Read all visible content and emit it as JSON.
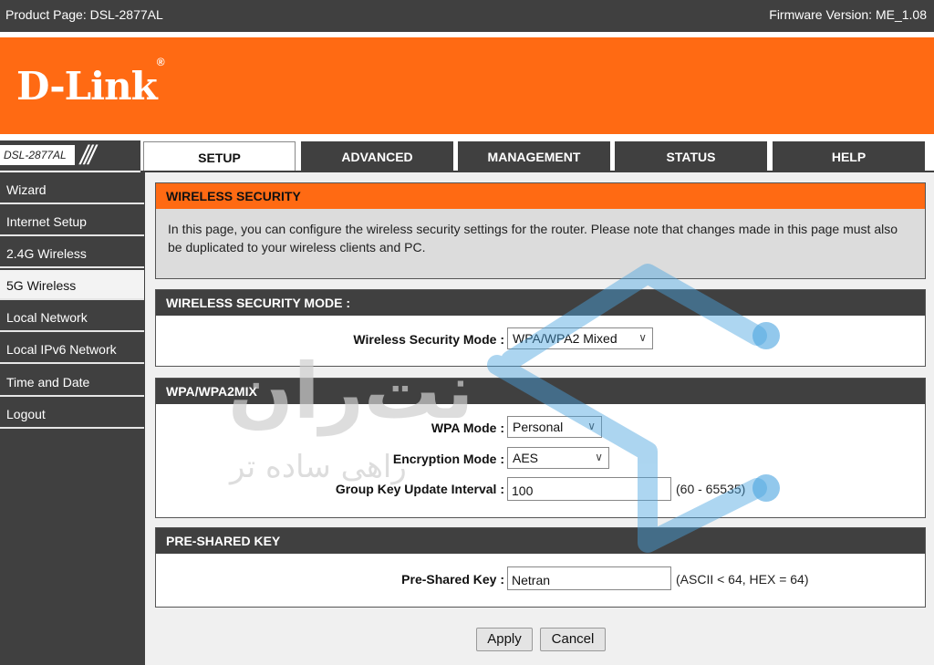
{
  "topbar": {
    "product": "Product Page: DSL-2877AL",
    "firmware": "Firmware Version: ME_1.08"
  },
  "brand": {
    "logo": "D-Link",
    "reg": "®"
  },
  "model": {
    "label": "DSL-2877AL",
    "slashes": "///"
  },
  "tabs": [
    {
      "label": "SETUP",
      "active": true
    },
    {
      "label": "ADVANCED"
    },
    {
      "label": "MANAGEMENT"
    },
    {
      "label": "STATUS"
    },
    {
      "label": "HELP"
    }
  ],
  "sidebar": {
    "items": [
      {
        "label": "Wizard"
      },
      {
        "label": "Internet Setup"
      },
      {
        "label": "2.4G Wireless"
      },
      {
        "label": "5G Wireless",
        "active": true
      },
      {
        "label": "Local Network"
      },
      {
        "label": "Local IPv6 Network"
      },
      {
        "label": "Time and Date"
      },
      {
        "label": "Logout"
      }
    ]
  },
  "intro": {
    "title": "WIRELESS SECURITY",
    "text": "In this page, you can configure the wireless security settings for the router. Please note that changes made in this page must also be duplicated to your wireless clients and PC."
  },
  "security_mode": {
    "title": "WIRELESS SECURITY MODE :",
    "label": "Wireless Security Mode :",
    "value": "WPA/WPA2 Mixed"
  },
  "wpa": {
    "title": "WPA/WPA2MIX",
    "mode_label": "WPA Mode :",
    "mode_value": "Personal",
    "enc_label": "Encryption Mode :",
    "enc_value": "AES",
    "interval_label": "Group Key Update Interval :",
    "interval_value": "100",
    "interval_hint": "(60 - 65535)"
  },
  "psk": {
    "title": "PRE-SHARED KEY",
    "label": "Pre-Shared Key :",
    "value": "Netran",
    "hint": "(ASCII < 64, HEX = 64)"
  },
  "buttons": {
    "apply": "Apply",
    "cancel": "Cancel"
  },
  "watermark": {
    "line1": "نت‌ران",
    "line2": "راهی ساده تر"
  },
  "colors": {
    "orange": "#ff6a13",
    "dark": "#404040",
    "watermark_blue": "#4aa3df"
  },
  "icons": {
    "dropdown": "chevron-down-icon"
  }
}
